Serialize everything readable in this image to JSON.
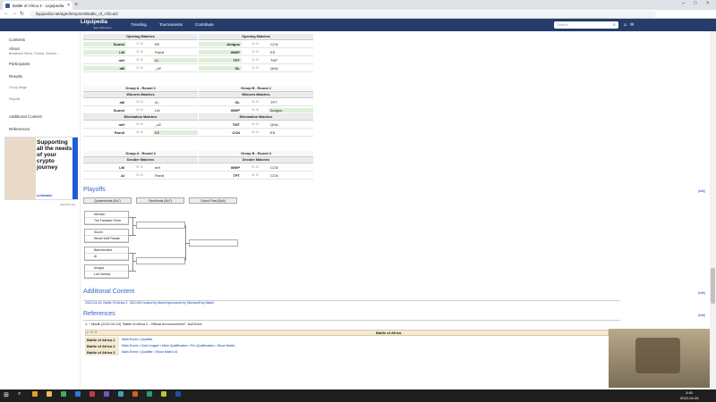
{
  "browser": {
    "tab_title": "Battle of Africa 2 - Liquipedia",
    "url": "liquipedia.net/ageofempires/Battle_of_Africa/2"
  },
  "site": {
    "name": "Liquipedia",
    "sub": "Age of Empires",
    "menu": [
      "Trending",
      "Tournaments",
      "Contribute"
    ],
    "search_placeholder": "Search"
  },
  "sidebar": {
    "contents": "Contents",
    "about": "About",
    "about_sub": "Broadcast Talent, Format, Schedu...",
    "participants": "Participants",
    "results": "Results",
    "group_stage": "Group Stage",
    "playoffs": "Playoffs",
    "additional": "Additional Content",
    "references": "References"
  },
  "ad": {
    "text": "Supporting all the needs of your crypto journey",
    "brand": "coinbase",
    "report": "REPORT AD"
  },
  "groupA": {
    "r1": {
      "title": "Opening Matches",
      "rows": [
        {
          "l": "Suomi",
          "s": "1 : 0",
          "r": "EE",
          "w": "l"
        },
        {
          "l": "LM",
          "s": "2 : 0",
          "r": "Parnil",
          "w": "l"
        },
        {
          "l": "mH",
          "s": "0 : 2",
          "r": "AI",
          "w": "r"
        },
        {
          "l": "xM",
          "s": "2 : 0",
          "r": "_dZ",
          "w": "l"
        }
      ]
    },
    "r2": {
      "title": "Group A - Round 2",
      "edit": "[hide]",
      "win_title": "Winners Matches",
      "win": [
        {
          "l": "xM",
          "s": "0 : 0",
          "r": "AI",
          "w": ""
        },
        {
          "l": "Suomi",
          "s": "0 : 0",
          "r": "LM",
          "w": ""
        }
      ],
      "elim_title": "Elimination Matches",
      "elim": [
        {
          "l": "mH",
          "s": "0 : 0",
          "r": "_dZ",
          "w": ""
        },
        {
          "l": "Parnil",
          "s": "0 : 2",
          "r": "EE",
          "w": "r"
        }
      ]
    },
    "r3": {
      "title": "Group A - Round 3",
      "dec": "Decider Matches",
      "rows": [
        {
          "l": "LM",
          "s": "0 : 2",
          "r": "mH",
          "w": ""
        },
        {
          "l": "AI",
          "s": "0 : 0",
          "r": "Parnil",
          "w": ""
        }
      ]
    }
  },
  "groupB": {
    "r1": {
      "title": "Opening Matches",
      "rows": [
        {
          "l": "Amigos",
          "s": "2 : 0",
          "r": "CCN",
          "w": "l"
        },
        {
          "l": "WWP",
          "s": "2 : 0",
          "r": "ES",
          "w": "l"
        },
        {
          "l": "TPT",
          "s": "2 : 0",
          "r": "TMT",
          "w": "l"
        },
        {
          "l": "GL",
          "s": "2 : 0",
          "r": "QHA",
          "w": "l"
        }
      ]
    },
    "r2": {
      "title": "Group B - Round 2",
      "edit": "[hide]",
      "win_title": "Winners Matches",
      "win": [
        {
          "l": "GL",
          "s": "0 : 0",
          "r": "TPT",
          "w": ""
        },
        {
          "l": "WWP",
          "s": "0 : 3",
          "r": "Amigos",
          "w": "r"
        }
      ],
      "elim_title": "Elimination Matches",
      "elim": [
        {
          "l": "TMT",
          "s": "0 : 0",
          "r": "QHA",
          "w": ""
        },
        {
          "l": "CCN",
          "s": "0 : 0",
          "r": "ES",
          "w": ""
        }
      ]
    },
    "r3": {
      "title": "Group B - Round 3",
      "dec": "Decider Matches",
      "rows": [
        {
          "l": "WWP",
          "s": "0 : 0",
          "r": "CCN",
          "w": ""
        },
        {
          "l": "TPT",
          "s": "0 : 0",
          "r": "CCN",
          "w": ""
        }
      ]
    }
  },
  "playoffs": {
    "title": "Playoffs",
    "edit": "[edit]",
    "stages": [
      "Quarterfinals (Bo7)",
      "Semifinals (Bo7)",
      "Grand Final (Bo9)"
    ],
    "qf": [
      [
        "Mermen",
        "The Fantastic Three"
      ],
      [
        "Suomi",
        "Whole Wolf Parade"
      ],
      [
        "Barnstromers",
        "AI"
      ],
      [
        "Amigos",
        "Los Harmos"
      ]
    ]
  },
  "additional": {
    "title": "Additional Content",
    "item": "2022-04-24: Battle Of Africa 2 - $10,000 hosted by Manili sponsored by Microsoft by Manili"
  },
  "references": {
    "title": "References",
    "ref1": "1. ↑ Manili (2022-04-24) \"Battle of Africa 2 - Official Announcement\". AoEZone.",
    "navbox_title": "Battle of Africa",
    "navbox_ctrl": "v · d · e",
    "rows": [
      {
        "k": "Battle of Africa 1",
        "v": "Main Event • Qualifier"
      },
      {
        "k": "Battle of Africa 2",
        "v": "Main Event • Gold League • Main Qualification • Pre-Qualification • Show Match"
      },
      {
        "k": "Battle of Africa 3",
        "v": "Main Event • Qualifier • Show Match #1"
      }
    ]
  },
  "taskbar": {
    "time": "3:45",
    "date": "2022-04-26"
  },
  "ui": {
    "edit": "[edit]"
  }
}
